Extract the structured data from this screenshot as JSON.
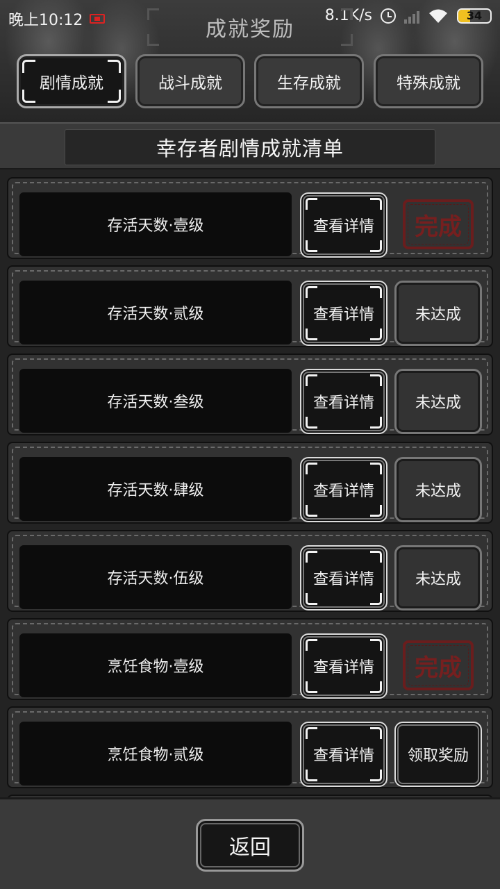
{
  "status_bar": {
    "time": "晚上10:12",
    "net_speed": "8.1K/s",
    "battery": "34",
    "icons": [
      "recording-icon",
      "alarm-clock-icon",
      "cellular-signal-icon",
      "wifi-icon",
      "battery-icon"
    ]
  },
  "header": {
    "title": "成就奖励"
  },
  "tabs": [
    {
      "label": "剧情成就",
      "active": true
    },
    {
      "label": "战斗成就",
      "active": false
    },
    {
      "label": "生存成就",
      "active": false
    },
    {
      "label": "特殊成就",
      "active": false
    }
  ],
  "subtitle": "幸存者剧情成就清单",
  "achievements": [
    {
      "name": "存活天数·壹级",
      "detail_label": "查看详情",
      "status": "completed",
      "status_label": "完成"
    },
    {
      "name": "存活天数·贰级",
      "detail_label": "查看详情",
      "status": "pending",
      "status_label": "未达成"
    },
    {
      "name": "存活天数·叁级",
      "detail_label": "查看详情",
      "status": "pending",
      "status_label": "未达成"
    },
    {
      "name": "存活天数·肆级",
      "detail_label": "查看详情",
      "status": "pending",
      "status_label": "未达成"
    },
    {
      "name": "存活天数·伍级",
      "detail_label": "查看详情",
      "status": "pending",
      "status_label": "未达成"
    },
    {
      "name": "烹饪食物·壹级",
      "detail_label": "查看详情",
      "status": "completed",
      "status_label": "完成"
    },
    {
      "name": "烹饪食物·贰级",
      "detail_label": "查看详情",
      "status": "claimable",
      "status_label": "领取奖励"
    }
  ],
  "footer": {
    "back_label": "返回"
  },
  "colors": {
    "stamp": "#7a1e1e",
    "battery_fill": "#f0c020",
    "recording": "#dd2222"
  }
}
